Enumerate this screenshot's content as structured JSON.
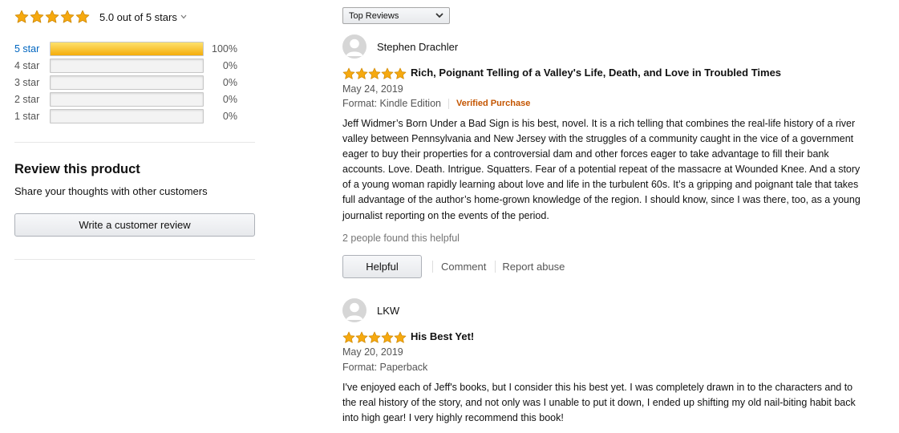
{
  "summary": {
    "rating": 5.0,
    "text": "5.0 out of 5 stars",
    "chevron": "⌵"
  },
  "histogram": [
    {
      "label": "5 star",
      "percent_text": "100%",
      "fraction": 1.0,
      "active": true
    },
    {
      "label": "4 star",
      "percent_text": "0%",
      "fraction": 0.0,
      "active": false
    },
    {
      "label": "3 star",
      "percent_text": "0%",
      "fraction": 0.0,
      "active": false
    },
    {
      "label": "2 star",
      "percent_text": "0%",
      "fraction": 0.0,
      "active": false
    },
    {
      "label": "1 star",
      "percent_text": "0%",
      "fraction": 0.0,
      "active": false
    }
  ],
  "review_product": {
    "title": "Review this product",
    "subtitle": "Share your thoughts with other customers",
    "button_label": "Write a customer review"
  },
  "sort": {
    "selected": "Top Reviews"
  },
  "colors": {
    "star": "#f6a90f",
    "link": "#0066c0",
    "verified": "#c45500"
  },
  "reviews": [
    {
      "name": "Stephen Drachler",
      "rating": 5,
      "title": "Rich, Poignant Telling of a Valley's Life, Death, and Love in Troubled Times",
      "date": "May 24, 2019",
      "format": "Format: Kindle Edition",
      "verified": "Verified Purchase",
      "body_lines": [
        "Jeff Widmer’s Born Under a Bad Sign is his best, novel. It is a rich telling that combines the real-life history of a river",
        "valley between Pennsylvania and New Jersey with the struggles of a community caught in the vice of a government",
        "eager to buy their properties for a controversial dam and other forces eager to take advantage to fill their bank",
        "accounts. Love. Death. Intrigue. Squatters. Fear of a potential repeat of the massacre at Wounded Knee. And a story",
        "of a young woman rapidly learning about love and life in the turbulent 60s. It’s a gripping and poignant tale that takes",
        "full advantage of the author’s home-grown knowledge of the region. I should know, since I was there, too, as a young",
        "journalist reporting on the events of the period."
      ],
      "helpful_count": "2 people found this helpful",
      "helpful_label": "Helpful",
      "comment_label": "Comment",
      "report_label": "Report abuse"
    },
    {
      "name": "LKW",
      "rating": 5,
      "title": "His Best Yet!",
      "date": "May 20, 2019",
      "format": "Format: Paperback",
      "body_lines": [
        "I've enjoyed each of Jeff's books, but I consider this his best yet. I was completely drawn in to the characters and to",
        "the real history of the story, and not only was I unable to put it down, I ended up shifting my old nail-biting habit back",
        "into high gear! I very highly recommend this book!"
      ]
    }
  ]
}
